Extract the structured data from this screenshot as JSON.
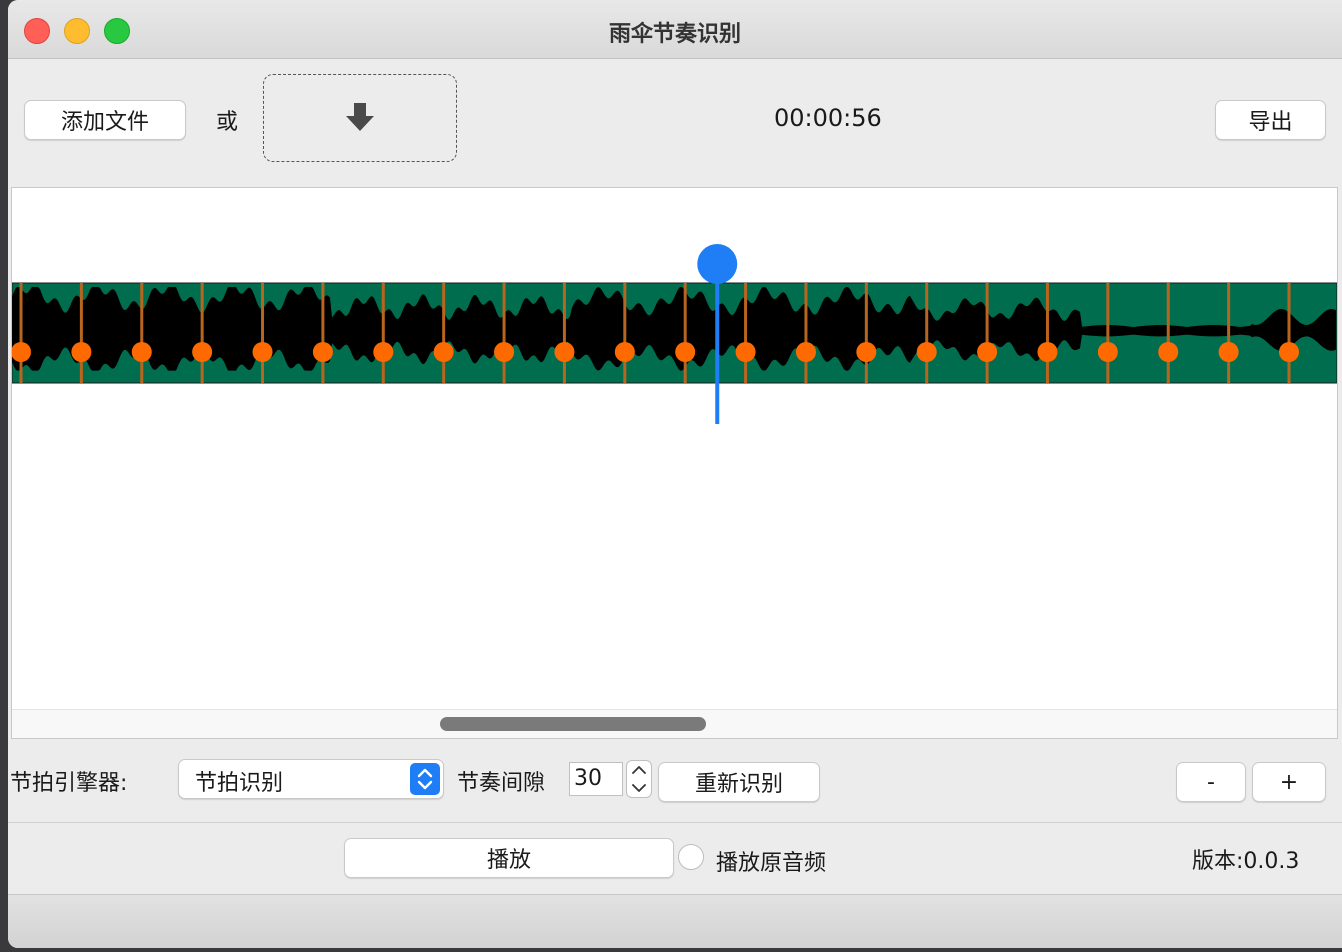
{
  "window": {
    "title": "雨伞节奏识别",
    "traffic_lights": [
      "#ff5f57",
      "#febc2e",
      "#28c840"
    ]
  },
  "toolbar": {
    "add_file_label": "添加文件",
    "or_label": "或",
    "drop_icon": "down-arrow-icon",
    "time_display": "00:00:56",
    "export_label": "导出"
  },
  "waveform": {
    "track_color": "#006e4e",
    "wave_color": "#000000",
    "beat_marker_color": "#ff6a00",
    "beat_line_color": "#b8651f",
    "playhead_color": "#1f7ef5",
    "beat_count": 22,
    "playhead_progress": 0.53,
    "scroll_position": 0.32
  },
  "controls": {
    "engine_label": "节拍引擎器:",
    "engine_selected": "节拍识别",
    "gap_label": "节奏间隙",
    "gap_value": "30",
    "reidentify_label": "重新识别",
    "zoom_out_label": "-",
    "zoom_in_label": "+"
  },
  "footer": {
    "play_label": "播放",
    "play_original_label": "播放原音频",
    "version_label": "版本:0.0.3"
  }
}
